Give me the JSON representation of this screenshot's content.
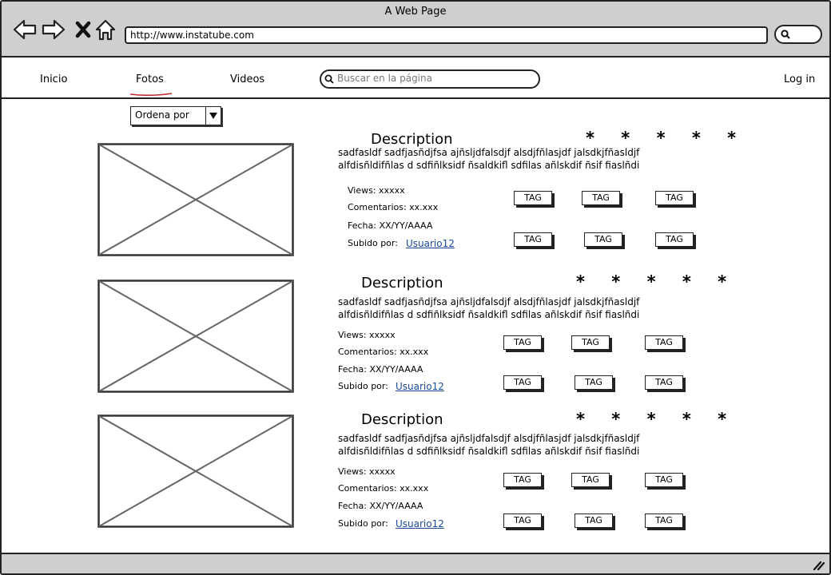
{
  "window": {
    "title": "A Web Page"
  },
  "browser": {
    "url": "http://www.instatube.com"
  },
  "nav": {
    "links": [
      "Inicio",
      "Fotos",
      "Videos"
    ],
    "login": "Log in",
    "search_placeholder": "Buscar en la página"
  },
  "sort": {
    "label": "Ordena por"
  },
  "items": [
    {
      "title": "Description",
      "stars": "* * * * *",
      "line1": "sadfasldf  sadfjasñdjfsa  ajñsljdfalsdjf  alsdjfñlasjdf  jalsdkjfñasldjf",
      "line2": "alfdisñldifñlas d sdfiñlksidf  ñsaldkifl sdfilas  añlskdif ñsif   fiaslñdi",
      "views": "Views: xxxxx",
      "comments": "Comentarios: xx.xxx",
      "date": "Fecha: XX/YY/AAAA",
      "uploaded_by": "Subido por:",
      "user": "Usuario12",
      "tags": [
        "TAG",
        "TAG",
        "TAG",
        "TAG",
        "TAG",
        "TAG"
      ]
    },
    {
      "title": "Description",
      "stars": "* * * * *",
      "line1": "sadfasldf  sadfjasñdjfsa  ajñsljdfalsdjf  alsdjfñlasjdf  jalsdkjfñasldjf",
      "line2": "alfdisñldifñlas d sdfiñlksidf  ñsaldkifl sdfilas  añlskdif ñsif   fiaslñdi",
      "views": "Views: xxxxx",
      "comments": "Comentarios: xx.xxx",
      "date": "Fecha: XX/YY/AAAA",
      "uploaded_by": "Subido por:",
      "user": "Usuario12",
      "tags": [
        "TAG",
        "TAG",
        "TAG",
        "TAG",
        "TAG",
        "TAG"
      ]
    },
    {
      "title": "Description",
      "stars": "* * * * *",
      "line1": "sadfasldf  sadfjasñdjfsa  ajñsljdfalsdjf  alsdjfñlasjdf  jalsdkjfñasldjf",
      "line2": "alfdisñldifñlas d sdfiñlksidf  ñsaldkifl sdfilas  añlskdif ñsif   fiaslñdi",
      "views": "Views: xxxxx",
      "comments": "Comentarios: xx.xxx",
      "date": "Fecha: XX/YY/AAAA",
      "uploaded_by": "Subido por:",
      "user": "Usuario12",
      "tags": [
        "TAG",
        "TAG",
        "TAG",
        "TAG",
        "TAG",
        "TAG"
      ]
    }
  ]
}
